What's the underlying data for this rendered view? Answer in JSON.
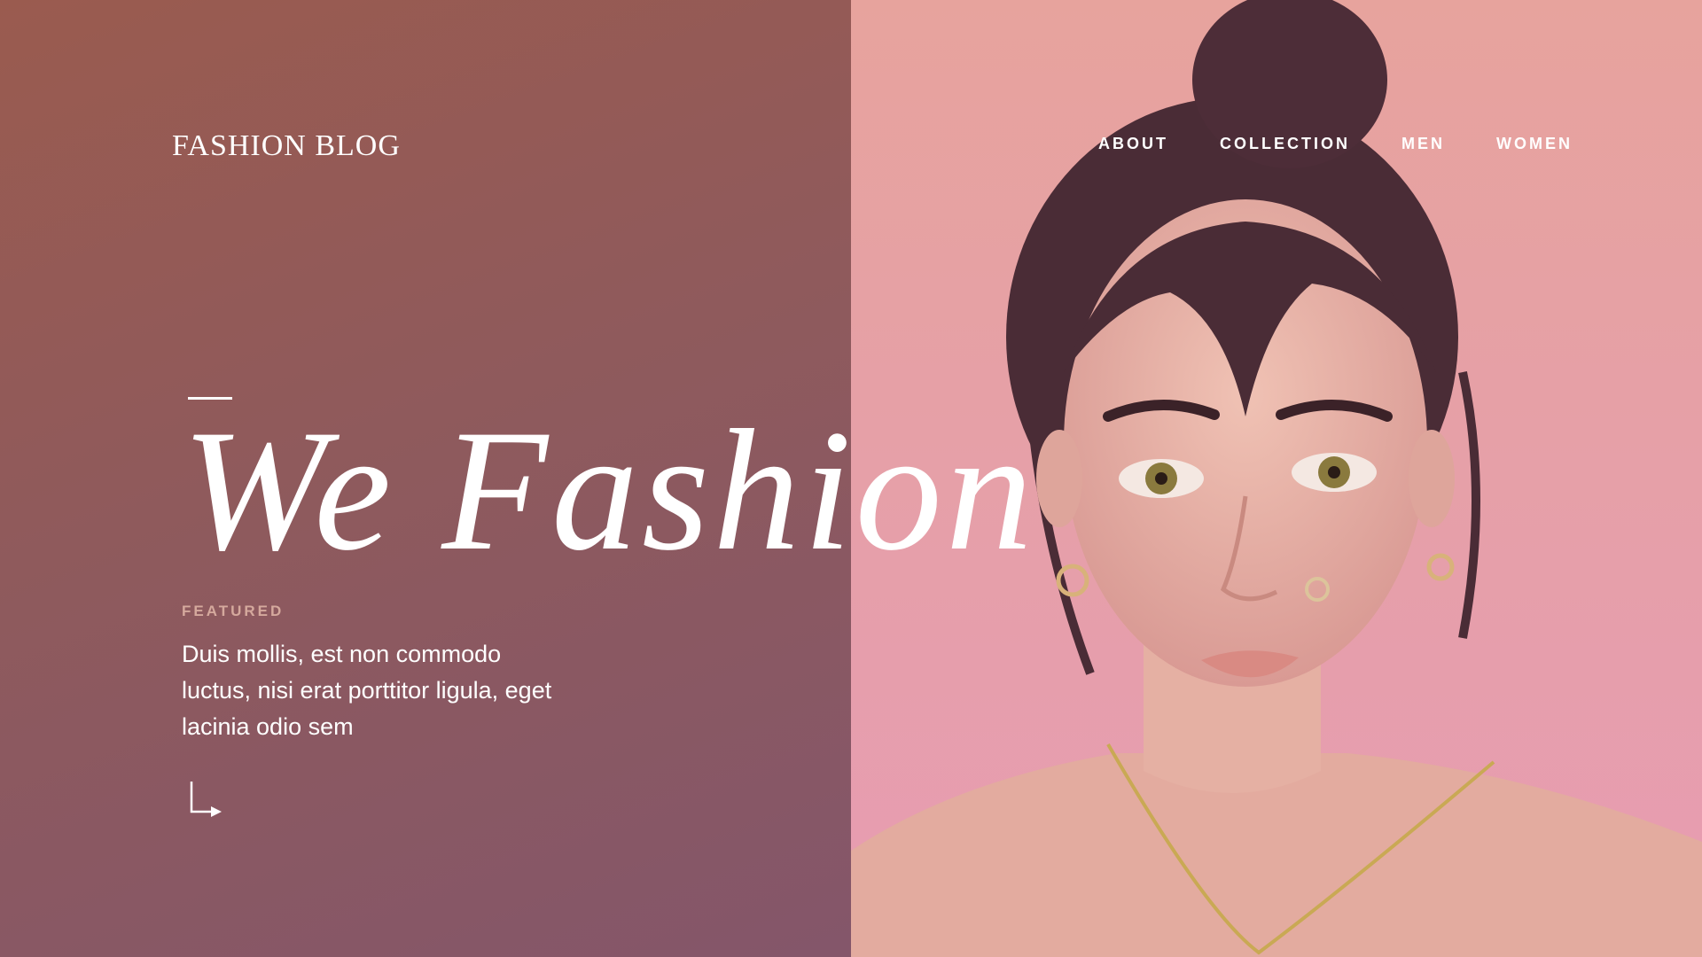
{
  "brand": {
    "logo": "FASHION BLOG"
  },
  "nav": {
    "items": [
      {
        "label": "ABOUT"
      },
      {
        "label": "COLLECTION"
      },
      {
        "label": "MEN"
      },
      {
        "label": "WOMEN"
      }
    ]
  },
  "hero": {
    "headline": "We Fashion",
    "featured_label": "FEATURED",
    "description": "Duis mollis, est non commodo luctus, nisi erat porttitor ligula, eget lacinia odio sem"
  },
  "colors": {
    "left_panel": "#8f5a5c",
    "right_panel": "#e6a0a7",
    "featured_text": "#d5a99d"
  },
  "icons": {
    "cta": "arrow-down-right-icon"
  }
}
